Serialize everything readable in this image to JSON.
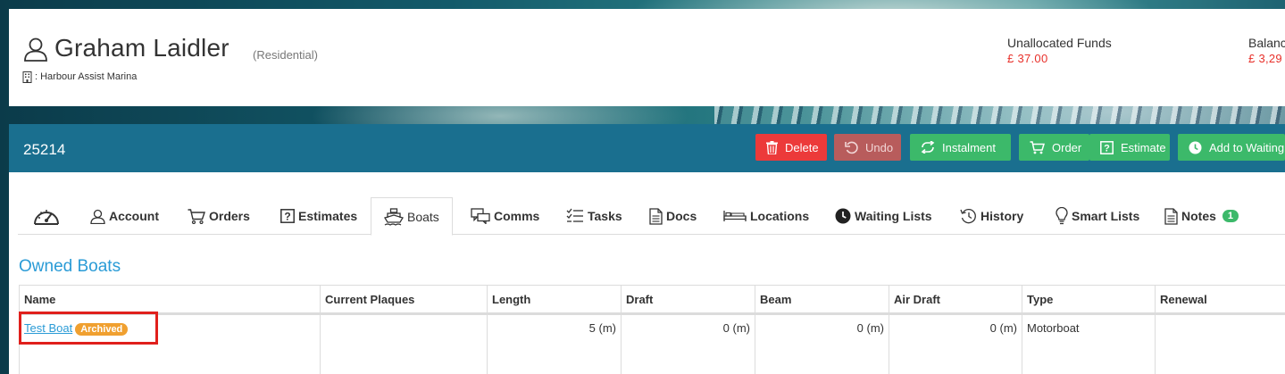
{
  "customer": {
    "name": "Graham Laidler",
    "type": "(Residential)",
    "marina": ": Harbour Assist Marina"
  },
  "funds": {
    "unallocated_label": "Unallocated Funds",
    "unallocated_value": "£ 37.00",
    "balance_label": "Balanc",
    "balance_value": "£ 3,29"
  },
  "account_bar": {
    "number": "25214",
    "buttons": {
      "delete": "Delete",
      "undo": "Undo",
      "instalment": "Instalment",
      "order": "Order",
      "estimate": "Estimate",
      "waiting": "Add to Waiting L"
    }
  },
  "tabs": {
    "account": "Account",
    "orders": "Orders",
    "estimates": "Estimates",
    "boats": "Boats",
    "comms": "Comms",
    "tasks": "Tasks",
    "docs": "Docs",
    "locations": "Locations",
    "waiting_lists": "Waiting Lists",
    "history": "History",
    "smart_lists": "Smart Lists",
    "notes": "Notes",
    "notes_count": "1"
  },
  "section_title": "Owned Boats",
  "table": {
    "columns": [
      "Name",
      "Current Plaques",
      "Length",
      "Draft",
      "Beam",
      "Air Draft",
      "Type",
      "Renewal"
    ],
    "rows": [
      {
        "name": "Test Boat",
        "status": "Archived",
        "plaques": "",
        "length": "5 (m)",
        "draft": "0 (m)",
        "beam": "0 (m)",
        "air_draft": "0 (m)",
        "type": "Motorboat",
        "renewal": ""
      }
    ]
  },
  "colors": {
    "account_bar": "#1a6f8f",
    "delete": "#ec3a3a",
    "undo": "#b85c5c",
    "green": "#3cb96a",
    "link": "#2a9bd6",
    "archived": "#f0a030",
    "funds": "#e8302a",
    "highlight": "#e0201c"
  },
  "icons": {
    "customer": "person-icon",
    "marina": "building-icon",
    "delete": "trash-icon",
    "undo": "undo-icon",
    "instalment": "repeat-icon",
    "order": "cart-icon",
    "estimate": "question-box-icon",
    "waiting": "clock-icon",
    "dashboard": "gauge-icon"
  }
}
